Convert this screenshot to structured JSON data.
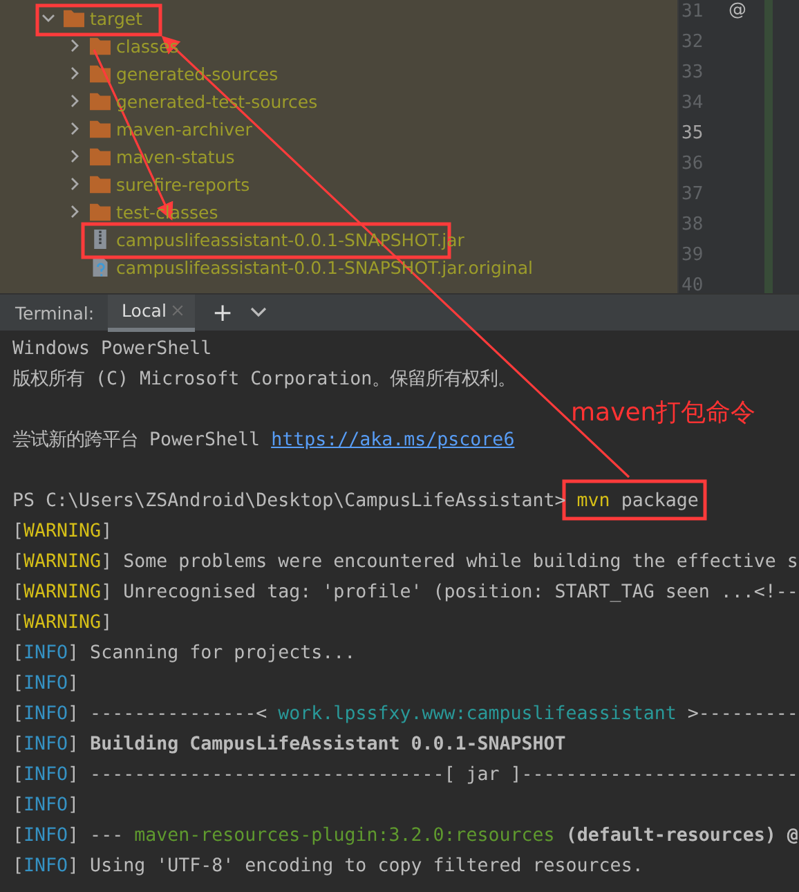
{
  "project_tree": [
    {
      "label": "target",
      "kind": "folder",
      "expanded": true,
      "children": [
        {
          "label": "classes",
          "kind": "folder",
          "expanded": false
        },
        {
          "label": "generated-sources",
          "kind": "folder",
          "expanded": false
        },
        {
          "label": "generated-test-sources",
          "kind": "folder",
          "expanded": false
        },
        {
          "label": "maven-archiver",
          "kind": "folder",
          "expanded": false
        },
        {
          "label": "maven-status",
          "kind": "folder",
          "expanded": false
        },
        {
          "label": "surefire-reports",
          "kind": "folder",
          "expanded": false
        },
        {
          "label": "test-classes",
          "kind": "folder",
          "expanded": false
        },
        {
          "label": "campuslifeassistant-0.0.1-SNAPSHOT.jar",
          "kind": "jar"
        },
        {
          "label": "campuslifeassistant-0.0.1-SNAPSHOT.jar.original",
          "kind": "unknown"
        }
      ]
    }
  ],
  "editor_gutter": {
    "line_numbers": [
      {
        "text": "31",
        "current": false
      },
      {
        "text": "32",
        "current": false
      },
      {
        "text": "33",
        "current": false
      },
      {
        "text": "34",
        "current": false
      },
      {
        "text": "35",
        "current": true
      },
      {
        "text": "36",
        "current": false
      },
      {
        "text": "37",
        "current": false
      },
      {
        "text": "38",
        "current": false
      },
      {
        "text": "39",
        "current": false
      },
      {
        "text": "40",
        "current": false
      }
    ],
    "marker": "@"
  },
  "terminal": {
    "label": "Terminal:",
    "tabs": [
      {
        "label": "Local",
        "selected": true
      }
    ],
    "add_button": "+",
    "blank_lines_before": [
      false,
      false,
      true,
      true,
      false,
      false,
      false,
      false,
      false,
      false,
      false,
      false,
      false,
      false,
      false,
      false
    ],
    "lines": [
      [
        {
          "text": "Windows PowerShell",
          "kind": "plain"
        }
      ],
      [
        {
          "text": "版权所有 (C) Microsoft Corporation。保留所有权利。",
          "kind": "plain"
        }
      ],
      [
        {
          "text": "尝试新的跨平台 PowerShell ",
          "kind": "plain"
        },
        {
          "text": "https://aka.ms/pscore6",
          "kind": "link"
        }
      ],
      [
        {
          "text": "PS C:\\Users\\ZSAndroid\\Desktop\\CampusLifeAssistant> ",
          "kind": "plain"
        },
        {
          "text": "mvn",
          "kind": "command"
        },
        {
          "text": " package",
          "kind": "plain"
        }
      ],
      [
        {
          "text": "[",
          "kind": "plain"
        },
        {
          "text": "WARNING",
          "kind": "warning"
        },
        {
          "text": "]",
          "kind": "plain"
        }
      ],
      [
        {
          "text": "[",
          "kind": "plain"
        },
        {
          "text": "WARNING",
          "kind": "warning"
        },
        {
          "text": "] Some problems were encountered while building the effective s",
          "kind": "plain"
        }
      ],
      [
        {
          "text": "[",
          "kind": "plain"
        },
        {
          "text": "WARNING",
          "kind": "warning"
        },
        {
          "text": "] Unrecognised tag: 'profile' (position: START_TAG seen ...<!--",
          "kind": "plain"
        }
      ],
      [
        {
          "text": "[",
          "kind": "plain"
        },
        {
          "text": "WARNING",
          "kind": "warning"
        },
        {
          "text": "]",
          "kind": "plain"
        }
      ],
      [
        {
          "text": "[",
          "kind": "plain"
        },
        {
          "text": "INFO",
          "kind": "info"
        },
        {
          "text": "] Scanning for projects...",
          "kind": "plain"
        }
      ],
      [
        {
          "text": "[",
          "kind": "plain"
        },
        {
          "text": "INFO",
          "kind": "info"
        },
        {
          "text": "]",
          "kind": "plain"
        }
      ],
      [
        {
          "text": "[",
          "kind": "plain"
        },
        {
          "text": "INFO",
          "kind": "info"
        },
        {
          "text": "] ---------------< ",
          "kind": "plain"
        },
        {
          "text": "work.lpssfxy.www:campuslifeassistant",
          "kind": "artifact"
        },
        {
          "text": " >---------",
          "kind": "plain"
        }
      ],
      [
        {
          "text": "[",
          "kind": "plain"
        },
        {
          "text": "INFO",
          "kind": "info"
        },
        {
          "text": "] ",
          "kind": "plain"
        },
        {
          "text": "Building CampusLifeAssistant 0.0.1-SNAPSHOT",
          "kind": "bold"
        }
      ],
      [
        {
          "text": "[",
          "kind": "plain"
        },
        {
          "text": "INFO",
          "kind": "info"
        },
        {
          "text": "] --------------------------------[ jar ]-------------------------",
          "kind": "plain"
        }
      ],
      [
        {
          "text": "[",
          "kind": "plain"
        },
        {
          "text": "INFO",
          "kind": "info"
        },
        {
          "text": "]",
          "kind": "plain"
        }
      ],
      [
        {
          "text": "[",
          "kind": "plain"
        },
        {
          "text": "INFO",
          "kind": "info"
        },
        {
          "text": "] --- ",
          "kind": "plain"
        },
        {
          "text": "maven-resources-plugin:3.2.0:resources",
          "kind": "plugin"
        },
        {
          "text": " (default-resources) @",
          "kind": "bold"
        }
      ],
      [
        {
          "text": "[",
          "kind": "plain"
        },
        {
          "text": "INFO",
          "kind": "info"
        },
        {
          "text": "] Using 'UTF-8' encoding to copy filtered resources.",
          "kind": "plain"
        }
      ]
    ]
  },
  "annotation": {
    "text": "maven打包命令"
  }
}
